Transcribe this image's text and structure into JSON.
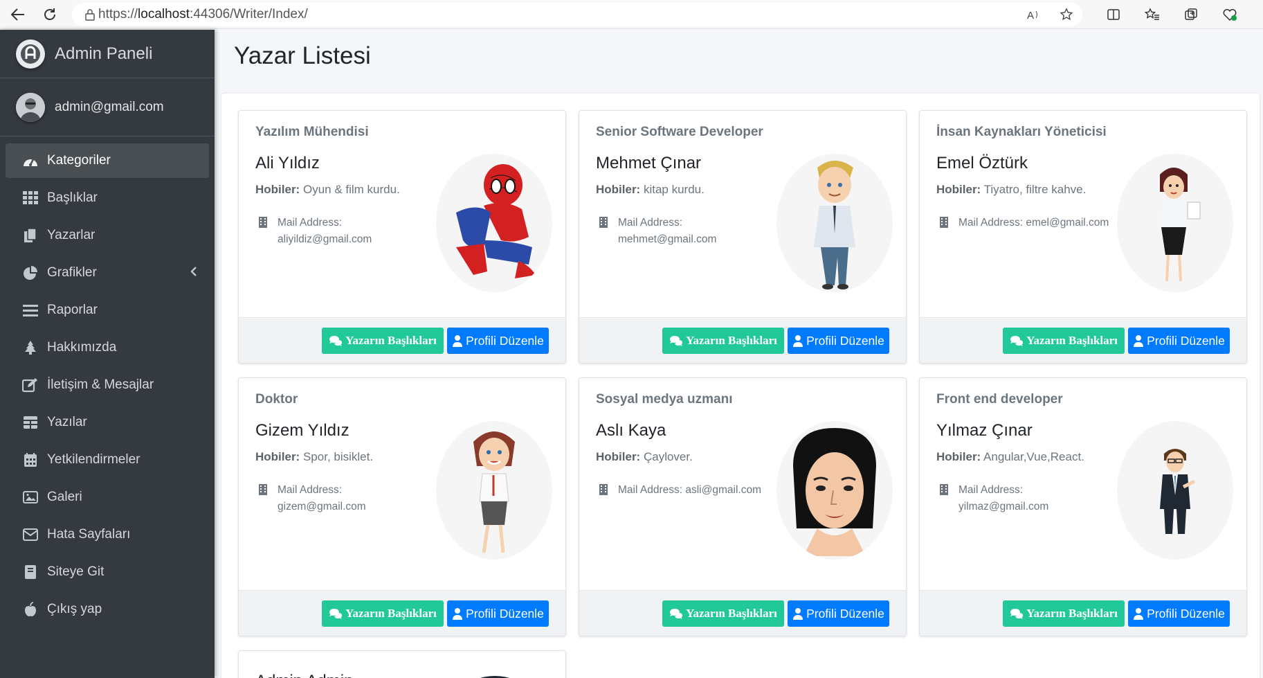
{
  "browser": {
    "url_prefix": "https://",
    "url_host": "localhost",
    "url_rest": ":44306/Writer/Index/"
  },
  "sidebar": {
    "brand": "Admin Paneli",
    "user_email": "admin@gmail.com",
    "items": [
      {
        "label": "Kategoriler",
        "icon": "tachometer-icon",
        "active": true
      },
      {
        "label": "Başlıklar",
        "icon": "grid-icon"
      },
      {
        "label": "Yazarlar",
        "icon": "copy-icon"
      },
      {
        "label": "Grafikler",
        "icon": "pie-chart-icon"
      },
      {
        "label": "Raporlar",
        "icon": "bars-icon"
      },
      {
        "label": "Hakkımızda",
        "icon": "tree-icon"
      },
      {
        "label": "İletişim & Mesajlar",
        "icon": "edit-icon"
      },
      {
        "label": "Yazılar",
        "icon": "table-icon"
      },
      {
        "label": "Yetkilendirmeler",
        "icon": "calendar-icon"
      },
      {
        "label": "Galeri",
        "icon": "image-icon"
      },
      {
        "label": "Hata Sayfaları",
        "icon": "envelope-icon"
      },
      {
        "label": "Siteye Git",
        "icon": "book-icon"
      },
      {
        "label": "Çıkış yap",
        "icon": "apple-icon"
      }
    ]
  },
  "main": {
    "title": "Yazar Listesi",
    "hobby_label": "Hobiler:",
    "btn_titles": "Yazarın Başlıkları",
    "btn_edit": "Profili Düzenle",
    "writers": [
      {
        "role": "Yazılım Mühendisi",
        "name": "Ali Yıldız",
        "hobby": "Oyun & film kurdu.",
        "mail_label": "Mail Address:",
        "mail": "aliyildiz@gmail.com"
      },
      {
        "role": "Senior Software Developer",
        "name": "Mehmet Çınar",
        "hobby": "kitap kurdu.",
        "mail_label": "Mail Address:",
        "mail": "mehmet@gmail.com"
      },
      {
        "role": "İnsan Kaynakları Yöneticisi",
        "name": "Emel Öztürk",
        "hobby": "Tiyatro, filtre kahve.",
        "mail_label": "Mail Address:",
        "mail": "emel@gmail.com"
      },
      {
        "role": "Doktor",
        "name": "Gizem Yıldız",
        "hobby": "Spor, bisiklet.",
        "mail_label": "Mail Address:",
        "mail": "gizem@gmail.com"
      },
      {
        "role": "Sosyal medya uzmanı",
        "name": "Aslı Kaya",
        "hobby": "Çaylover.",
        "mail_label": "Mail Address:",
        "mail": "asli@gmail.com"
      },
      {
        "role": "Front end developer",
        "name": "Yılmaz Çınar",
        "hobby": "Angular,Vue,React.",
        "mail_label": "Mail Address:",
        "mail": "yilmaz@gmail.com"
      }
    ],
    "partial_name": "Admin Admin"
  },
  "colors": {
    "sidebar": "#343a40",
    "green_button": "#20c997",
    "blue_button": "#007bff"
  }
}
